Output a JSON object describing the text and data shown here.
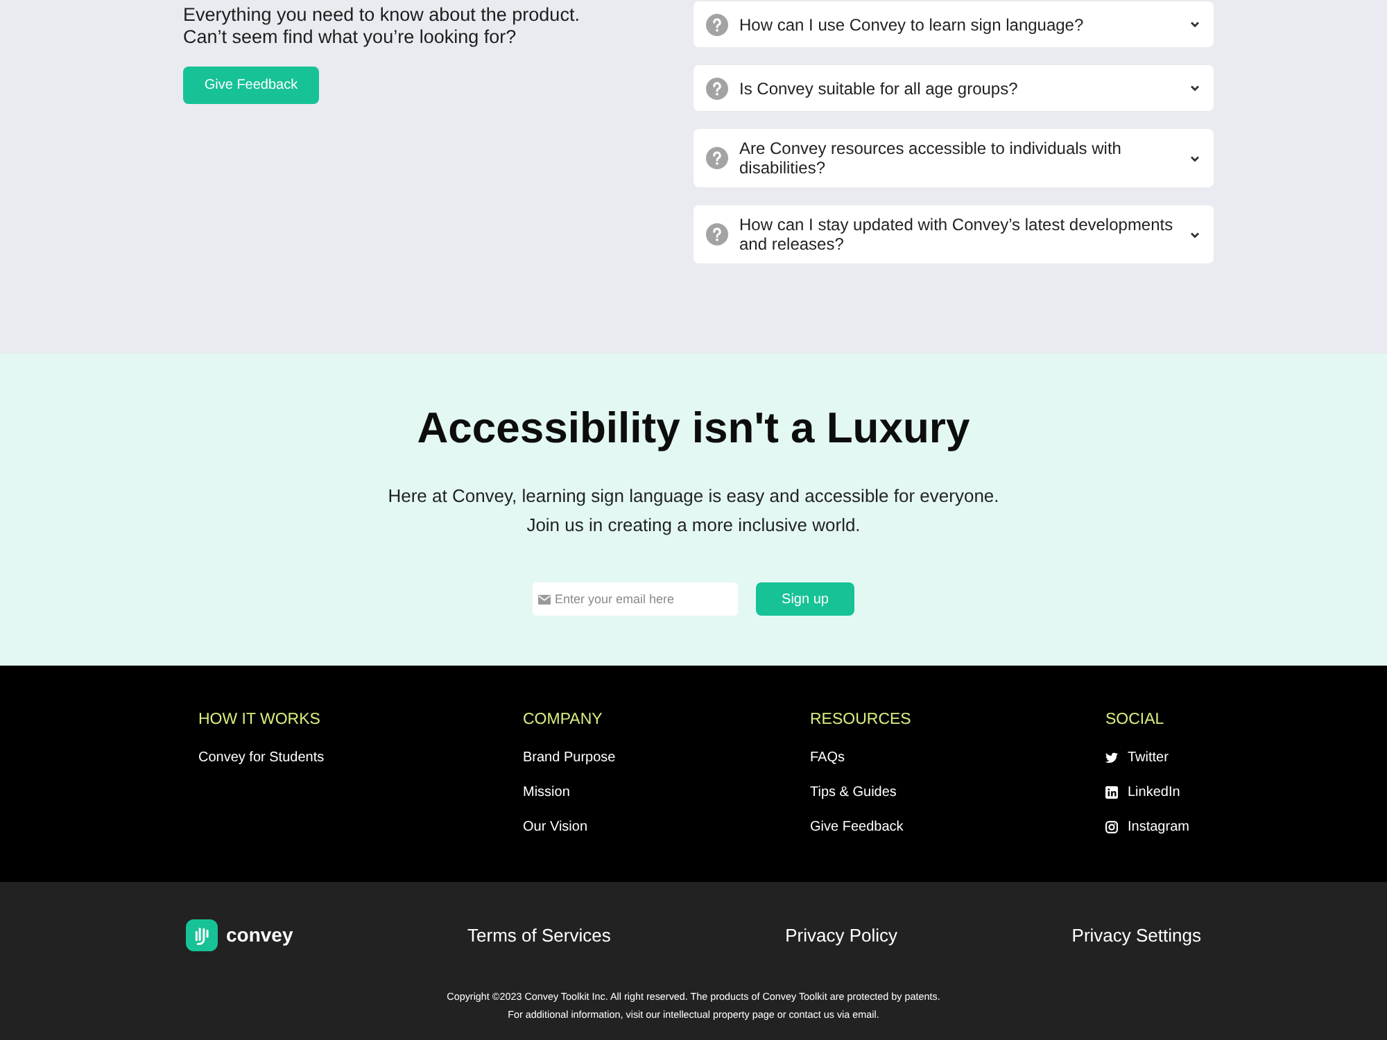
{
  "faq": {
    "intro_lines": [
      "Everything you need to know about the product.",
      "Can’t seem find what you’re looking for?"
    ],
    "button": "Give Feedback",
    "items": [
      {
        "question": "How can I use Convey to learn sign language?",
        "expanded": false
      },
      {
        "question": "Is Convey suitable for all age groups?",
        "expanded": false
      },
      {
        "question": "Are Convey resources accessible to individuals with disabilities?",
        "expanded": false
      },
      {
        "question": "How can I stay updated with Convey’s latest developments and releases?",
        "expanded": false
      }
    ]
  },
  "cta": {
    "title": "Accessibility isn't a Luxury",
    "lines": [
      "Here at Convey, learning sign language is easy and accessible for everyone.",
      "Join us in creating a more inclusive world."
    ],
    "email_field": {
      "placeholder": "Enter your email here"
    },
    "button": "Sign up"
  },
  "footer": {
    "columns": [
      {
        "heading": "HOW IT WORKS",
        "kind": "links",
        "links": [
          "Convey for Students"
        ]
      },
      {
        "heading": "COMPANY",
        "kind": "links",
        "links": [
          "Brand Purpose",
          "Mission",
          "Our Vision"
        ]
      },
      {
        "heading": "RESOURCES",
        "kind": "links",
        "links": [
          "FAQs",
          "Tips & Guides",
          "Give Feedback"
        ]
      },
      {
        "heading": "SOCIAL",
        "kind": "social",
        "links": [
          "Twitter",
          "LinkedIn",
          "Instagram"
        ]
      }
    ]
  },
  "bottom_bar": {
    "logo": "convey",
    "links": [
      "Terms of Services",
      "Privacy Policy",
      "Privacy Settings"
    ],
    "copyright": [
      "Copyright ©2023 Convey Toolkit Inc. All right reserved. The products of Convey Toolkit are protected by patents.",
      "For additional information, visit our intellectual property page or contact us via email."
    ]
  }
}
